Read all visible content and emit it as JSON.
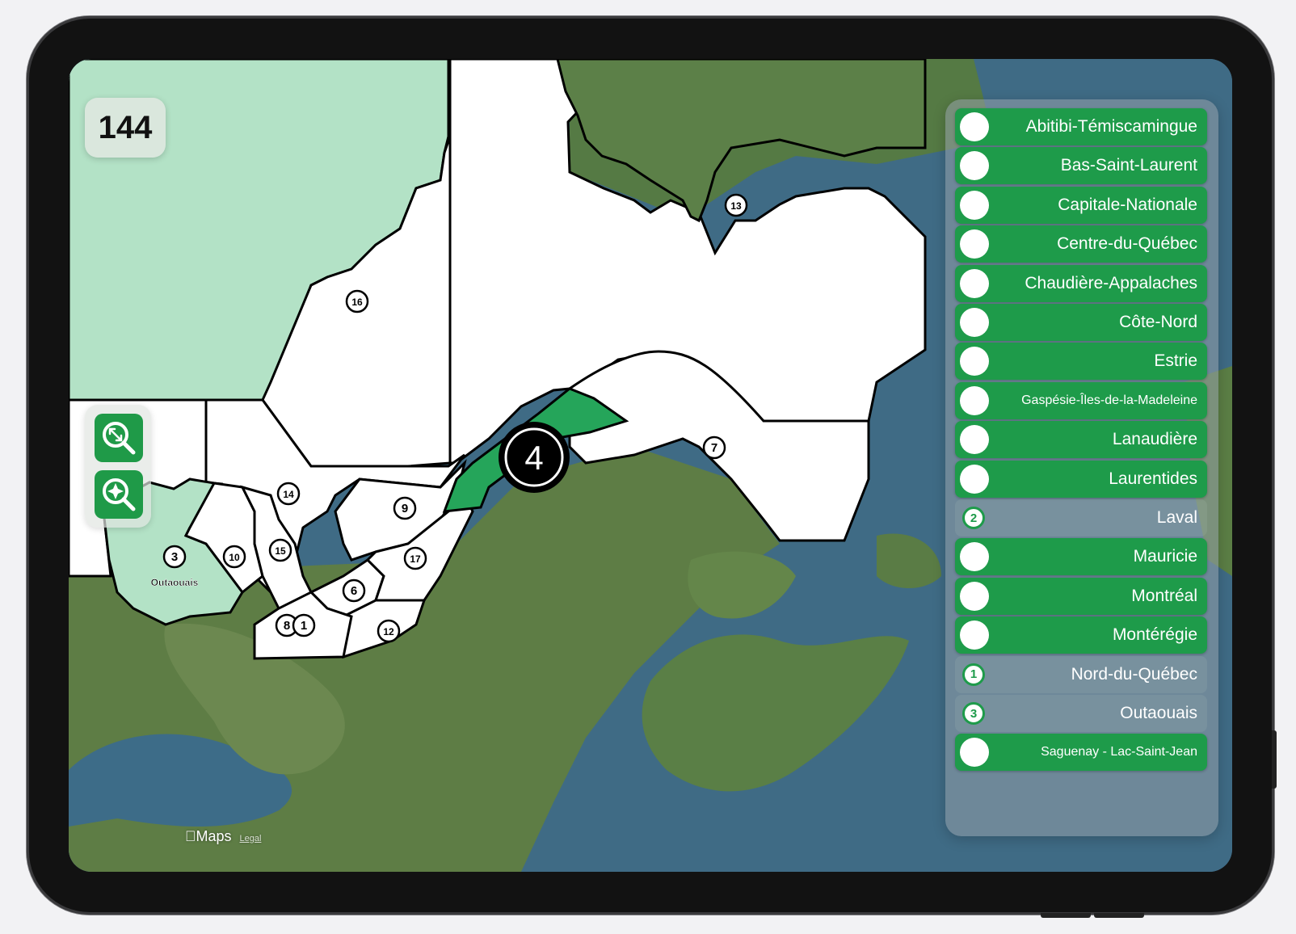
{
  "score": {
    "value": "144"
  },
  "map": {
    "selected_region_number": "4",
    "region_markers": [
      "16",
      "13",
      "14",
      "9",
      "7",
      "3",
      "10",
      "15",
      "17",
      "6",
      "8",
      "1",
      "12"
    ],
    "outaouais_label": "Outaouais",
    "colors": {
      "selected_fill": "#25a55a",
      "solved_fill": "#b3e2c6",
      "unsolved_fill": "#ffffff",
      "region_stroke": "#000000"
    }
  },
  "zoom": {
    "zoom_fit_icon": "zoom-fit-icon",
    "zoom_locate_icon": "zoom-locate-icon"
  },
  "maps_credit": {
    "brand": "Maps",
    "legal": "Legal"
  },
  "regions": [
    {
      "label": "Abitibi-Témiscamingue",
      "solved": false,
      "badge": ""
    },
    {
      "label": "Bas-Saint-Laurent",
      "solved": false,
      "badge": ""
    },
    {
      "label": "Capitale-Nationale",
      "solved": false,
      "badge": ""
    },
    {
      "label": "Centre-du-Québec",
      "solved": false,
      "badge": ""
    },
    {
      "label": "Chaudière-Appalaches",
      "solved": false,
      "badge": ""
    },
    {
      "label": "Côte-Nord",
      "solved": false,
      "badge": ""
    },
    {
      "label": "Estrie",
      "solved": false,
      "badge": ""
    },
    {
      "label": "Gaspésie-Îles-de-la-Madeleine",
      "solved": false,
      "badge": ""
    },
    {
      "label": "Lanaudière",
      "solved": false,
      "badge": ""
    },
    {
      "label": "Laurentides",
      "solved": false,
      "badge": ""
    },
    {
      "label": "Laval",
      "solved": true,
      "badge": "2"
    },
    {
      "label": "Mauricie",
      "solved": false,
      "badge": ""
    },
    {
      "label": "Montréal",
      "solved": false,
      "badge": ""
    },
    {
      "label": "Montérégie",
      "solved": false,
      "badge": ""
    },
    {
      "label": "Nord-du-Québec",
      "solved": true,
      "badge": "1"
    },
    {
      "label": "Outaouais",
      "solved": true,
      "badge": "3"
    },
    {
      "label": "Saguenay - Lac-Saint-Jean",
      "solved": false,
      "badge": ""
    }
  ]
}
